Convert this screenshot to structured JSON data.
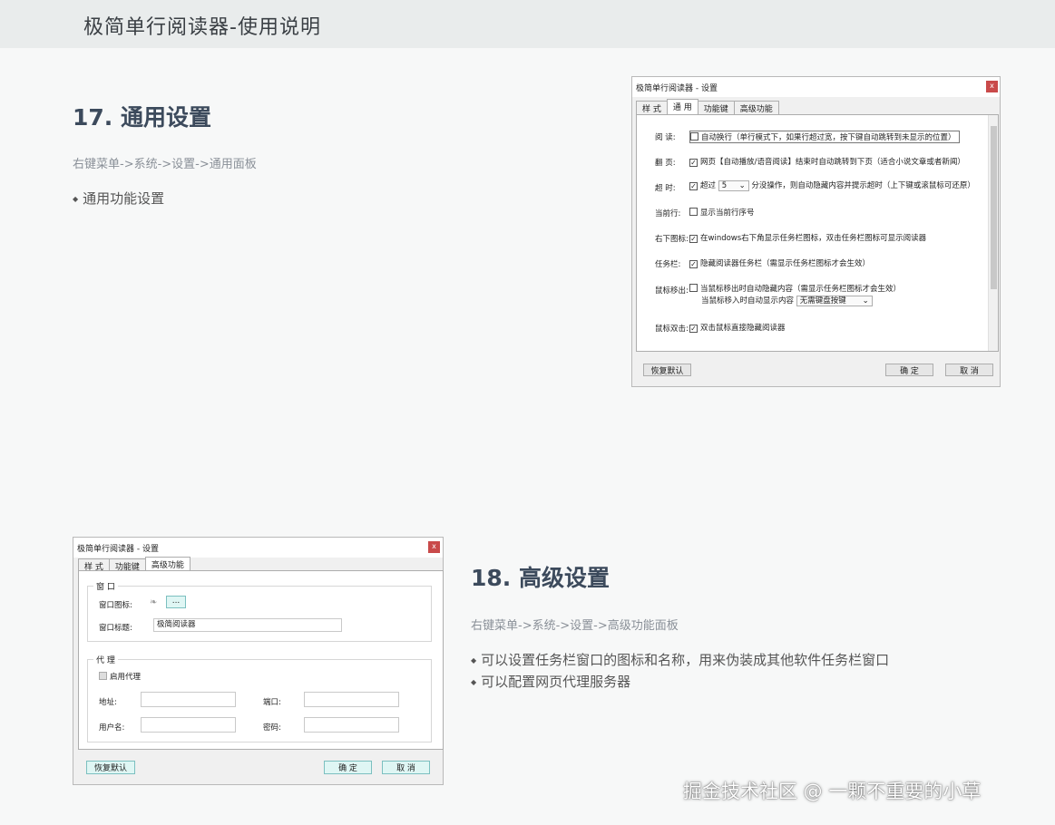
{
  "header": {
    "title": "极简单行阅读器-使用说明"
  },
  "section17": {
    "title": "17. 通用设置",
    "path": "右键菜单->系统->设置->通用面板",
    "bullets": [
      "通用功能设置"
    ]
  },
  "section18": {
    "title": "18. 高级设置",
    "path": "右键菜单->系统->设置->高级功能面板",
    "bullets": [
      "可以设置任务栏窗口的图标和名称，用来伪装成其他软件任务栏窗口",
      "可以配置网页代理服务器"
    ]
  },
  "dialog1": {
    "title": "极简单行阅读器 - 设置",
    "close": "x",
    "tabs": [
      "样 式",
      "通 用",
      "功能键",
      "高级功能"
    ],
    "rows": [
      {
        "label": "阅 读:",
        "checked": false,
        "text": "自动换行（单行模式下，如果行超过宽，按下键自动跳转到未显示的位置）"
      },
      {
        "label": "翻 页:",
        "checked": true,
        "text": "网页【自动播放/语音阅读】结束时自动跳转到下页（适合小说文章或者新闻）"
      },
      {
        "label": "超 时:",
        "checked": true,
        "text_before": "超过",
        "select": "5",
        "text": "分没操作，则自动隐藏内容并提示超时（上下键或滚鼠标可还原）"
      },
      {
        "label": "当前行:",
        "checked": false,
        "text": "显示当前行序号"
      },
      {
        "label": "右下图标:",
        "checked": true,
        "text": "在windows右下角显示任务栏图标，双击任务栏图标可显示阅读器"
      },
      {
        "label": "任务栏:",
        "checked": true,
        "text": "隐藏阅读器任务栏（需显示任务栏图标才会生效）"
      },
      {
        "label": "鼠标移出:",
        "checked": false,
        "text": "当鼠标移出时自动隐藏内容（需显示任务栏图标才会生效）"
      },
      {
        "label": "鼠标双击:",
        "checked": true,
        "text": "双击鼠标直接隐藏阅读器"
      }
    ],
    "mouse_in_text": "当鼠标移入时自动显示内容",
    "mouse_in_select": "无需键盘按键",
    "restore_button": "恢复默认",
    "ok_button": "确 定",
    "cancel_button": "取 消"
  },
  "dialog2": {
    "title": "极简单行阅读器 - 设置",
    "close": "x",
    "tabs": [
      "样 式",
      "功能键",
      "高级功能"
    ],
    "window_group": "窗 口",
    "icon_label": "窗口图标:",
    "browse": "...",
    "caption_label": "窗口标题:",
    "caption_value": "极简阅读器",
    "proxy_group": "代 理",
    "enable_proxy": "启用代理",
    "address_label": "地址:",
    "port_label": "端口:",
    "user_label": "用户名:",
    "password_label": "密码:",
    "restore_button": "恢复默认",
    "ok_button": "确 定",
    "cancel_button": "取 消"
  },
  "watermark": "掘金技术社区 @ 一颗不重要的小草"
}
